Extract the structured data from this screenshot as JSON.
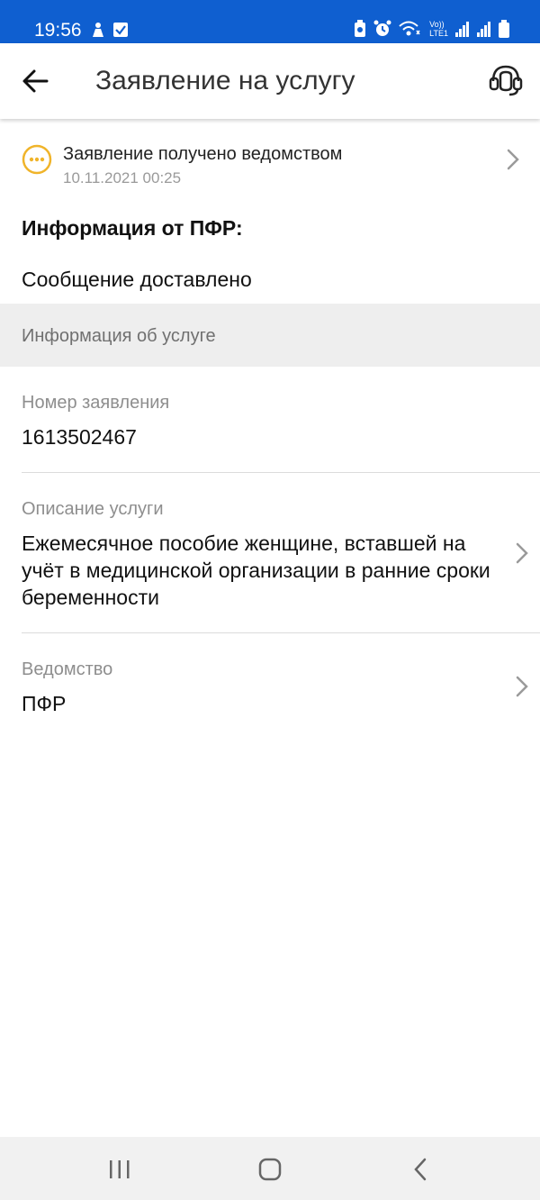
{
  "status_bar": {
    "time": "19:56",
    "left_icons": [
      "notification-person-icon",
      "checkbox-icon"
    ],
    "right_icons": [
      "battery-saver-icon",
      "alarm-icon",
      "wifi-icon",
      "volte-icon",
      "signal-icon",
      "signal-icon",
      "battery-icon"
    ],
    "volte_label": "Vo))",
    "lte_label": "LTE1"
  },
  "app_bar": {
    "title": "Заявление на услугу"
  },
  "status": {
    "title": "Заявление получено ведомством",
    "date": "10.11.2021 00:25",
    "color": "#f0b42a"
  },
  "info": {
    "heading": "Информация от ПФР:",
    "message": "Сообщение доставлено"
  },
  "service_section": {
    "title": "Информация об услуге"
  },
  "fields": {
    "number": {
      "label": "Номер заявления",
      "value": "1613502467"
    },
    "description": {
      "label": "Описание услуги",
      "value": "Ежемесячное пособие женщине, вставшей на учёт в медицинской организации в ранние сроки беременности"
    },
    "department": {
      "label": "Ведомство",
      "value": "ПФР"
    }
  },
  "colors": {
    "status_bar": "#0f5fd0",
    "accent": "#f0b42a"
  }
}
